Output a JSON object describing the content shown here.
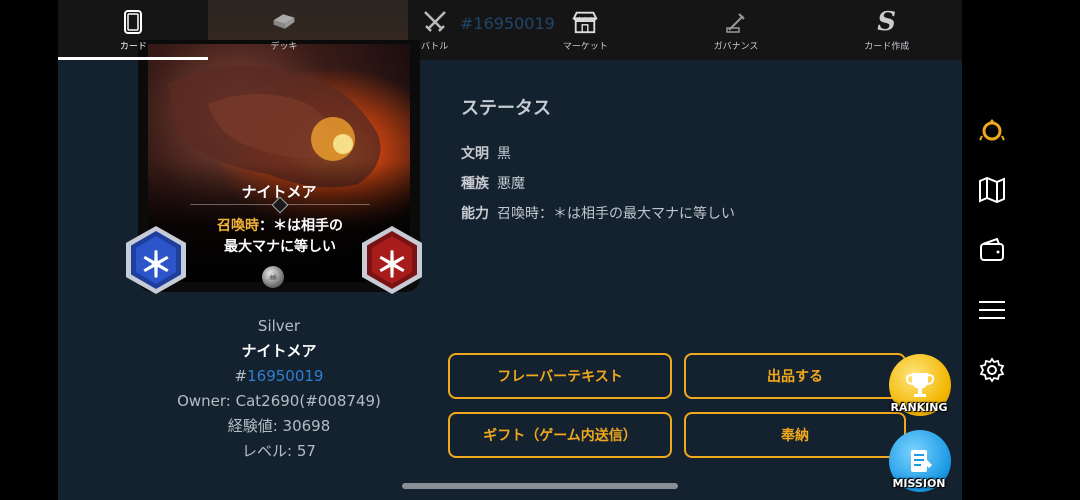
{
  "nav": {
    "items": [
      {
        "label": "カード",
        "icon": "card-icon"
      },
      {
        "label": "デッキ",
        "icon": "deck-icon"
      },
      {
        "label": "バトル",
        "icon": "battle-icon"
      },
      {
        "label": "マーケット",
        "icon": "market-icon"
      },
      {
        "label": "ガバナンス",
        "icon": "governance-icon"
      },
      {
        "label": "カード作成",
        "icon": "card-create-icon"
      }
    ],
    "overlay_id": "#16950019"
  },
  "card": {
    "name": "ナイトメア",
    "ability_keyword": "召喚時",
    "ability_line1_rest": "：＊は相手の",
    "ability_line2": "最大マナに等しい",
    "cost_symbol": "＊",
    "power_symbol": "＊"
  },
  "card_info": {
    "rarity": "Silver",
    "name": "ナイトメア",
    "id_hash": "#",
    "id_number": "16950019",
    "owner": "Owner: Cat2690(#008749)",
    "experience": "経験値: 30698",
    "level": "レベル: 57"
  },
  "status": {
    "title": "ステータス",
    "rows": [
      {
        "key": "文明",
        "value": "黒"
      },
      {
        "key": "種族",
        "value": "悪魔"
      },
      {
        "key": "能力",
        "value": "召喚時：＊は相手の最大マナに等しい"
      }
    ]
  },
  "actions": {
    "flavor_text": "フレーバーテキスト",
    "list_for_sale": "出品する",
    "gift": "ギフト（ゲーム内送信）",
    "dedicate": "奉納"
  },
  "badges": {
    "ranking": "RANKING",
    "mission": "MISSION"
  },
  "sidebar": {
    "icons": [
      "ring-icon",
      "map-icon",
      "wallet-icon",
      "menu-icon",
      "settings-icon"
    ]
  },
  "colors": {
    "accent": "#f0a81c",
    "panel": "#142230",
    "link": "#2e7fd0"
  }
}
